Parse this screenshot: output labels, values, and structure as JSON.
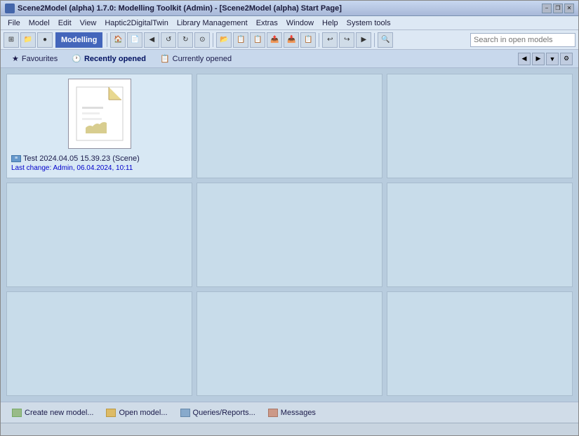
{
  "window": {
    "title": "Scene2Model (alpha) 1.7.0: Modelling Toolkit (Admin) - [Scene2Model (alpha) Start Page]",
    "controls": {
      "minimize": "−",
      "restore": "❐",
      "close": "✕"
    }
  },
  "menubar": {
    "items": [
      "File",
      "Model",
      "Edit",
      "View",
      "Haptic2DigitalTwin",
      "Library Management",
      "Extras",
      "Window",
      "Help",
      "System tools"
    ]
  },
  "toolbar": {
    "label": "Modelling",
    "search_placeholder": "Search in open models",
    "buttons": [
      "⊞",
      "📁",
      "💾",
      "←",
      "→",
      "↺",
      "↻",
      "🔍",
      "📋",
      "📄",
      "📋",
      "📤",
      "📥",
      "📋",
      "←",
      "→",
      "↩",
      "↪",
      "│",
      "🔍"
    ]
  },
  "tabs": {
    "items": [
      {
        "label": "Favourites",
        "icon": "★",
        "active": false
      },
      {
        "label": "Recently opened",
        "icon": "🕐",
        "active": true
      },
      {
        "label": "Currently opened",
        "icon": "📋",
        "active": false
      }
    ],
    "nav": {
      "prev": "◀",
      "next": "▶",
      "dropdown": "▼",
      "settings": "⚙"
    }
  },
  "grid": {
    "rows": 3,
    "cols": 3,
    "items": [
      {
        "id": 0,
        "has_content": true,
        "title": "Test 2024.04.05 15.39.23 (Scene)",
        "date_label": "Last change: Admin, 06.04.2024,",
        "time": " 10:11"
      }
    ]
  },
  "bottombar": {
    "buttons": [
      {
        "label": "Create new model...",
        "icon": "new"
      },
      {
        "label": "Open model...",
        "icon": "open"
      },
      {
        "label": "Queries/Reports...",
        "icon": "query"
      },
      {
        "label": "Messages",
        "icon": "msg"
      }
    ]
  }
}
